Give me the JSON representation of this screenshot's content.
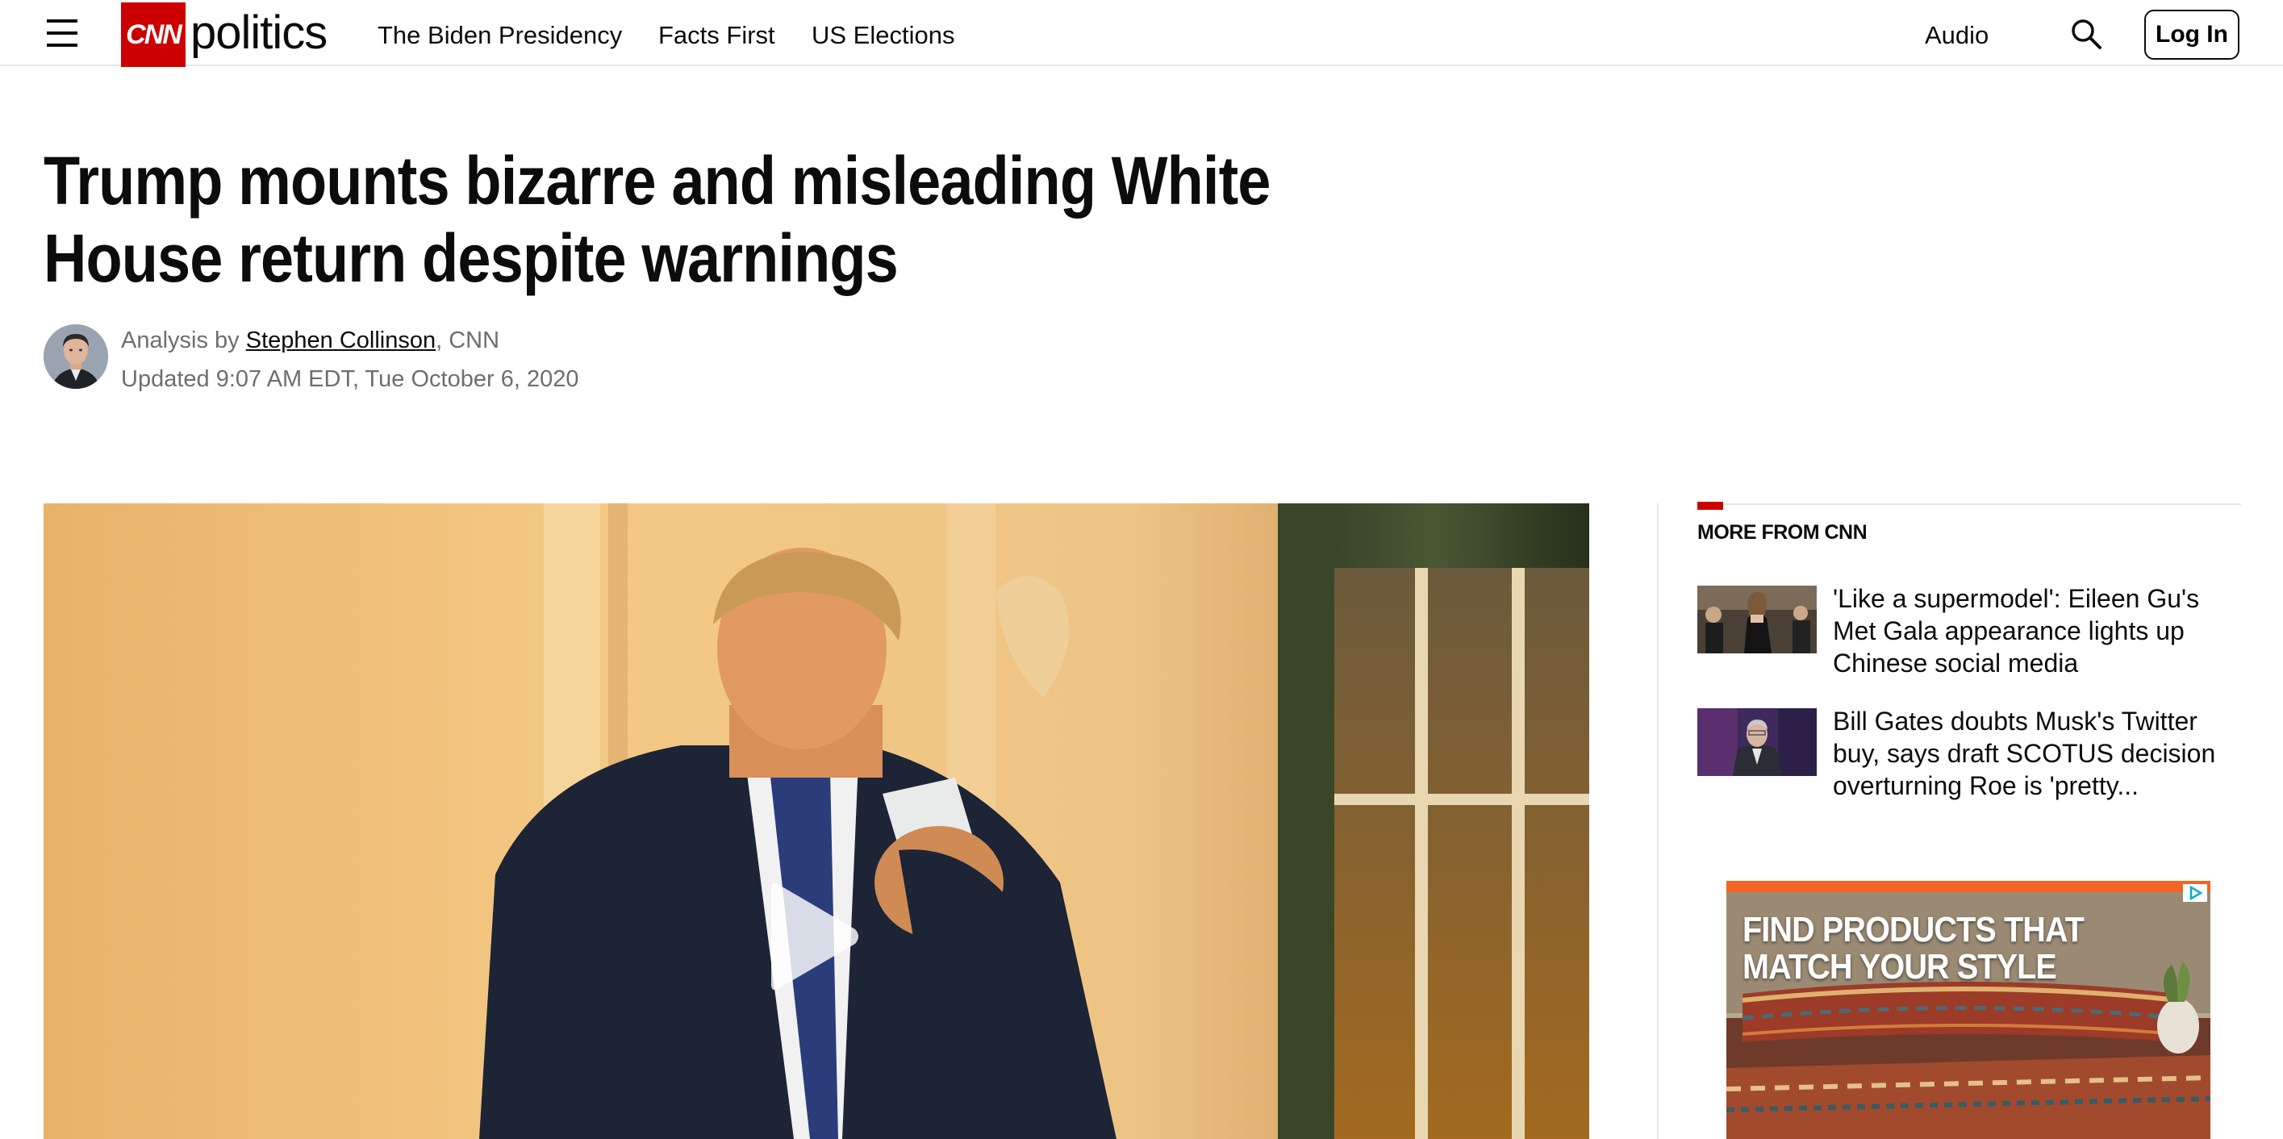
{
  "header": {
    "logo_brand": "CNN",
    "section_name": "politics",
    "nav_links": [
      "The Biden Presidency",
      "Facts First",
      "US Elections"
    ],
    "audio_label": "Audio",
    "login_label": "Log In"
  },
  "article": {
    "headline": "Trump mounts bizarre and misleading White House return despite warnings",
    "byline_prefix": "Analysis by ",
    "author": "Stephen Collinson",
    "byline_suffix": ", CNN",
    "updated": "Updated 9:07 AM EDT, Tue October 6, 2020"
  },
  "rail": {
    "title": "MORE FROM CNN",
    "items": [
      {
        "text": "'Like a supermodel': Eileen Gu's Met Gala appearance lights up Chinese social media"
      },
      {
        "text": "Bill Gates doubts Musk's Twitter buy, says draft SCOTUS decision overturning Roe is 'pretty..."
      }
    ]
  },
  "ad": {
    "headline": "FIND PRODUCTS THAT MATCH YOUR STYLE"
  },
  "colors": {
    "brand_red": "#cc0000",
    "text": "#0c0c0c",
    "meta_gray": "#6e6e6e",
    "divider": "#e6e6e6",
    "ad_accent": "#f26522"
  },
  "icons": {
    "menu": "hamburger-menu-icon",
    "search": "search-icon",
    "play": "play-icon",
    "ad_choices": "adchoices-icon"
  }
}
